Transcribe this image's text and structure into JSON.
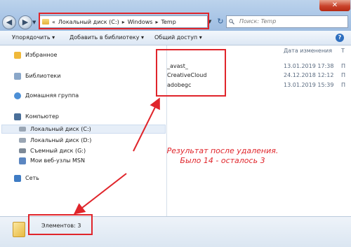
{
  "addressbar": {
    "chevrons": "«",
    "segments": [
      "Локальный диск (C:)",
      "Windows",
      "Temp"
    ],
    "separator": "▸"
  },
  "search": {
    "placeholder": "Поиск: Temp"
  },
  "toolbar": {
    "organize": "Упорядочить ▾",
    "include_library": "Добавить в библиотеку ▾",
    "share": "Общий доступ ▾",
    "help": "?"
  },
  "sidebar": {
    "favorites": "Избранное",
    "libraries": "Библиотеки",
    "homegroup": "Домашняя группа",
    "computer": "Компьютер",
    "drives": [
      "Локальный диск (C:)",
      "Локальный диск (D:)",
      "Съемный диск (G:)",
      "Мои веб-узлы MSN"
    ],
    "network": "Сеть"
  },
  "columns": {
    "date": "Дата изменения",
    "type": "Т"
  },
  "files": [
    {
      "name": "_avast_",
      "date": "13.01.2019 17:38",
      "type": "П"
    },
    {
      "name": "CreativeCloud",
      "date": "24.12.2018 12:12",
      "type": "П"
    },
    {
      "name": "adobegc",
      "date": "13.01.2019 15:39",
      "type": "П"
    }
  ],
  "status": {
    "text": "Элементов: 3"
  },
  "annotation": {
    "line1": "Результат после удаления.",
    "line2": "Было 14 - осталось 3",
    "color": "#e0252b"
  }
}
